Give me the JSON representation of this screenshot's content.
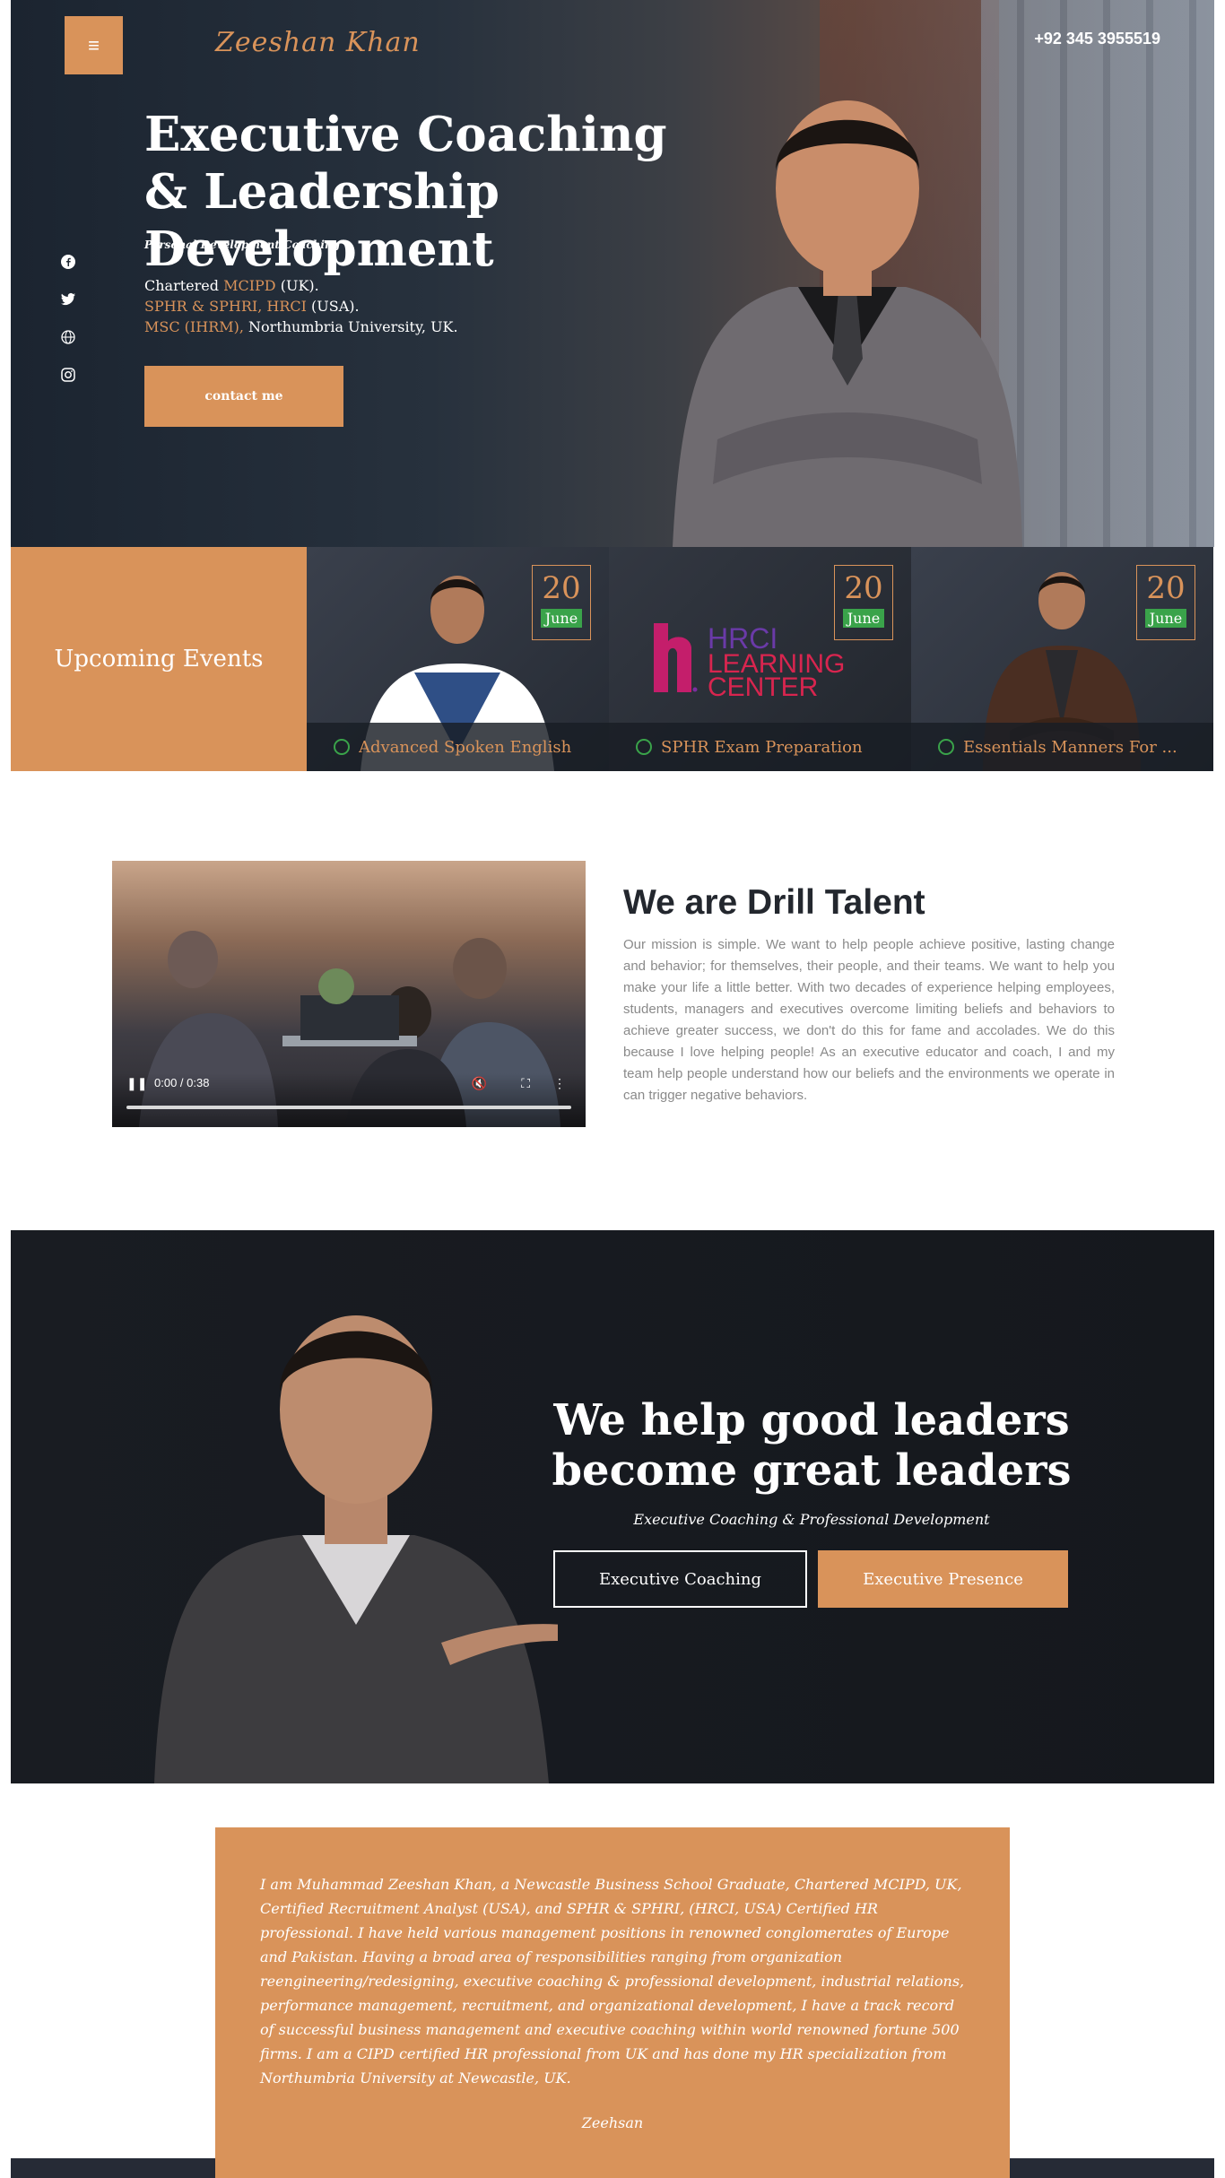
{
  "header": {
    "menu_icon": "hamburger-icon",
    "logo": "Zeeshan Khan",
    "phone": "+92 345 3955519"
  },
  "socials": [
    "facebook-icon",
    "twitter-icon",
    "globe-icon",
    "instagram-icon"
  ],
  "hero": {
    "title": "Executive Coaching & Leadership Development",
    "subtitle": "Personal Development Coaching",
    "cred1_prefix": "Chartered ",
    "cred1_accent": "MCIPD",
    "cred1_suffix": " (UK).",
    "cred2_accent": "SPHR & SPHRI, HRCI",
    "cred2_suffix": " (USA).",
    "cred3_accent": "MSC (IHRM),",
    "cred3_suffix": " Northumbria University, UK.",
    "cta": "contact me"
  },
  "events": {
    "label": "Upcoming Events",
    "items": [
      {
        "day": "20",
        "month": "June",
        "title": "Advanced Spoken English"
      },
      {
        "day": "20",
        "month": "June",
        "title": "SPHR Exam Preparation"
      },
      {
        "day": "20",
        "month": "June",
        "title": "Essentials Manners For ..."
      }
    ],
    "hrci_text": [
      "HRCI",
      "LEARNING",
      "CENTER"
    ]
  },
  "about": {
    "video_time": "0:00 / 0:38",
    "video_progress": 0,
    "title": "We are Drill Talent",
    "text": "Our mission is simple. We want to help people achieve positive, lasting change and behavior; for themselves, their people, and their teams. We want to help you make your life a little better. With two decades of experience helping employees, students, managers and executives overcome limiting beliefs and behaviors to achieve greater success, we don't do this for fame and accolades. We do this because I love helping people! As an executive educator and coach, I and my team help people understand how our beliefs and the environments we operate in can trigger negative behaviors."
  },
  "leaders": {
    "title": "We help good leaders become great leaders",
    "subtitle": "Executive Coaching & Professional Development",
    "btn_outline": "Executive Coaching",
    "btn_fill": "Executive Presence"
  },
  "bio": {
    "text": "I am Muhammad Zeeshan Khan, a Newcastle Business School Graduate, Chartered MCIPD, UK, Certified Recruitment Analyst (USA), and SPHR & SPHRI, (HRCI, USA) Certified HR professional. I have held various management positions in renowned conglomerates of Europe and Pakistan. Having a broad area of responsibilities ranging from organization reengineering/redesigning, executive coaching & professional development, industrial relations, performance management, recruitment, and organizational development, I have a track record of successful business management and executive coaching within world renowned fortune 500 firms. I am a CIPD certified HR professional from UK and has done my HR specialization from Northumbria University at Newcastle, UK.",
    "signature": "Zeehsan"
  },
  "colors": {
    "accent": "#d9935a",
    "green": "#3aa34a",
    "dark": "#23272e"
  }
}
